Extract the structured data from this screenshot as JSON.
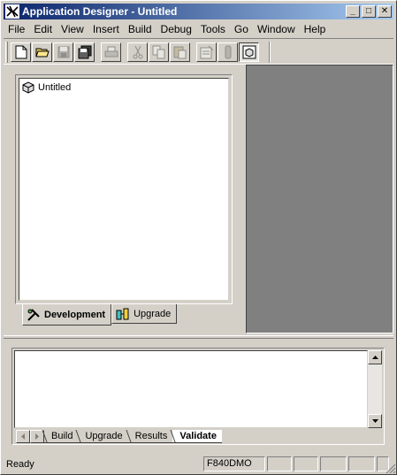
{
  "window": {
    "title": "Application Designer - Untitled",
    "controls": {
      "minimize": "_",
      "maximize": "□",
      "close": "✕"
    }
  },
  "menu": [
    {
      "label": "File"
    },
    {
      "label": "Edit"
    },
    {
      "label": "View"
    },
    {
      "label": "Insert"
    },
    {
      "label": "Build"
    },
    {
      "label": "Debug"
    },
    {
      "label": "Tools"
    },
    {
      "label": "Go"
    },
    {
      "label": "Window"
    },
    {
      "label": "Help"
    }
  ],
  "toolbar": {
    "buttons": [
      {
        "icon": "new-icon"
      },
      {
        "icon": "open-folder-icon"
      },
      {
        "icon": "save-icon"
      },
      {
        "icon": "save-all-icon"
      },
      {
        "icon": "print-icon"
      },
      {
        "icon": "cut-icon"
      },
      {
        "icon": "copy-icon"
      },
      {
        "icon": "paste-icon"
      },
      {
        "icon": "properties-icon"
      },
      {
        "icon": "build-icon"
      },
      {
        "icon": "workspace-icon"
      }
    ]
  },
  "project_tree": {
    "root_label": "Untitled"
  },
  "workspace_tabs": [
    {
      "label": "Development",
      "active": true
    },
    {
      "label": "Upgrade",
      "active": false
    }
  ],
  "output_tabs": [
    {
      "label": "Build",
      "active": false
    },
    {
      "label": "Upgrade",
      "active": false
    },
    {
      "label": "Results",
      "active": false
    },
    {
      "label": "Validate",
      "active": true
    }
  ],
  "status": {
    "text": "Ready",
    "database": "F840DMO",
    "cells": [
      "",
      "",
      "",
      "",
      ""
    ]
  },
  "colors": {
    "title_start": "#0a246a",
    "title_end": "#a6caf0",
    "face": "#d4d0c8",
    "mdi": "#808080"
  }
}
